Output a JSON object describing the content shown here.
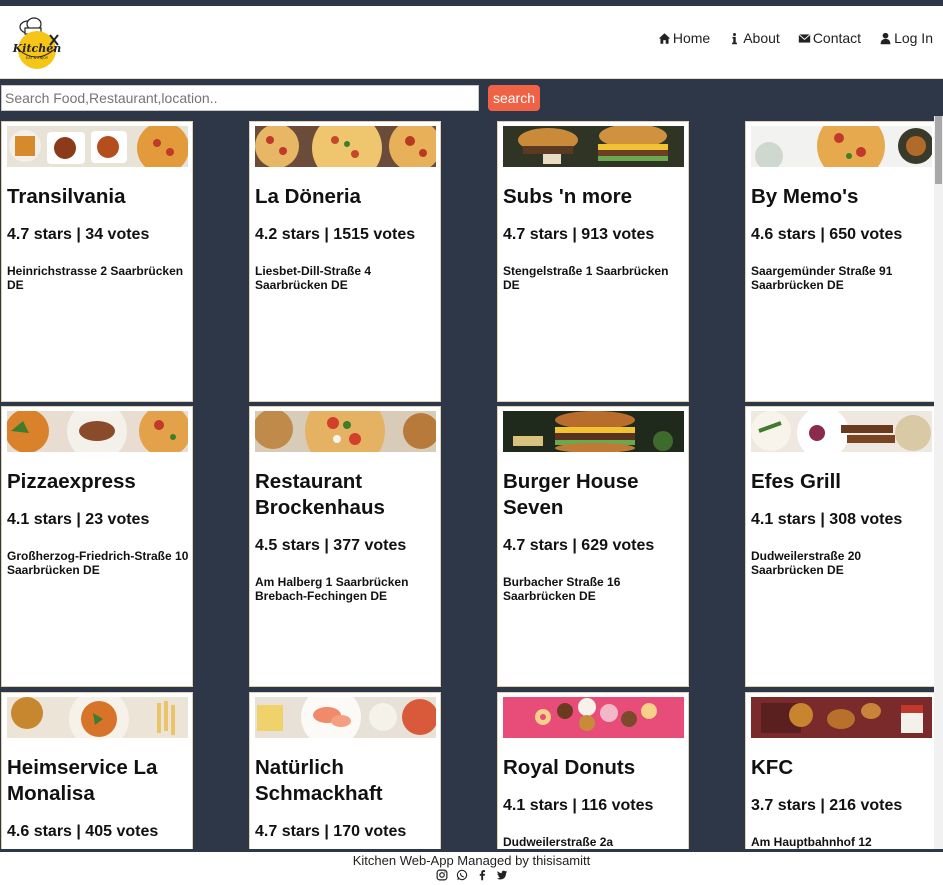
{
  "app": {
    "logo_text": "Kitchen",
    "logo_tagline": "EAT & ENJOY"
  },
  "nav": {
    "items": [
      {
        "label": "Home",
        "icon": "home-icon"
      },
      {
        "label": "About",
        "icon": "info-icon"
      },
      {
        "label": "Contact",
        "icon": "envelope-icon"
      },
      {
        "label": "Log In",
        "icon": "user-icon"
      }
    ]
  },
  "search": {
    "placeholder": "Search Food,Restaurant,location..",
    "value": "",
    "button_label": "search"
  },
  "restaurants": [
    {
      "name": "Transilvania",
      "rating": "4.7 stars | 34 votes",
      "address": "Heinrichstrasse 2 Saarbrücken DE",
      "image": "food-platter"
    },
    {
      "name": "La Döneria",
      "rating": "4.2 stars | 1515 votes",
      "address": "Liesbet-Dill-Straße 4 Saarbrücken DE",
      "image": "pizza"
    },
    {
      "name": "Subs 'n more",
      "rating": "4.7 stars | 913 votes",
      "address": "Stengelstraße 1 Saarbrücken DE",
      "image": "burger"
    },
    {
      "name": "By Memo's",
      "rating": "4.6 stars | 650 votes",
      "address": "Saargemünder Straße 91 Saarbrücken DE",
      "image": "pizza-table"
    },
    {
      "name": "Pizzaexpress",
      "rating": "4.1 stars | 23 votes",
      "address": "Großherzog-Friedrich-Straße 10 Saarbrücken DE",
      "image": "pasta-pizza"
    },
    {
      "name": "Restaurant Brockenhaus",
      "rating": "4.5 stars | 377 votes",
      "address": "Am Halberg 1 Saarbrücken Brebach-Fechingen DE",
      "image": "pizza-margherita"
    },
    {
      "name": "Burger House Seven",
      "rating": "4.7 stars | 629 votes",
      "address": "Burbacher Straße 16 Saarbrücken DE",
      "image": "burger-closeup"
    },
    {
      "name": "Efes Grill",
      "rating": "4.1 stars | 308 votes",
      "address": "Dudweilerstraße 20 Saarbrücken DE",
      "image": "grill-skewers"
    },
    {
      "name": "Heimservice La Monalisa",
      "rating": "4.6 stars | 405 votes",
      "address": "",
      "image": "rice-fries"
    },
    {
      "name": "Natürlich Schmackhaft",
      "rating": "4.7 stars | 170 votes",
      "address": "",
      "image": "salmon-plate"
    },
    {
      "name": "Royal Donuts",
      "rating": "4.1 stars | 116 votes",
      "address": "Dudweilerstraße 2a",
      "image": "donuts"
    },
    {
      "name": "KFC",
      "rating": "3.7 stars | 216 votes",
      "address": "Am Hauptbahnhof 12",
      "image": "fried-chicken"
    }
  ],
  "footer": {
    "text": "Kitchen Web-App Managed by thisisamitt",
    "social_icons": [
      "instagram-icon",
      "whatsapp-icon",
      "facebook-icon",
      "twitter-icon"
    ]
  },
  "colors": {
    "background": "#2d3748",
    "search_button": "#f06245",
    "card_border": "#e0cfb0",
    "logo_yellow": "#f5c518"
  }
}
